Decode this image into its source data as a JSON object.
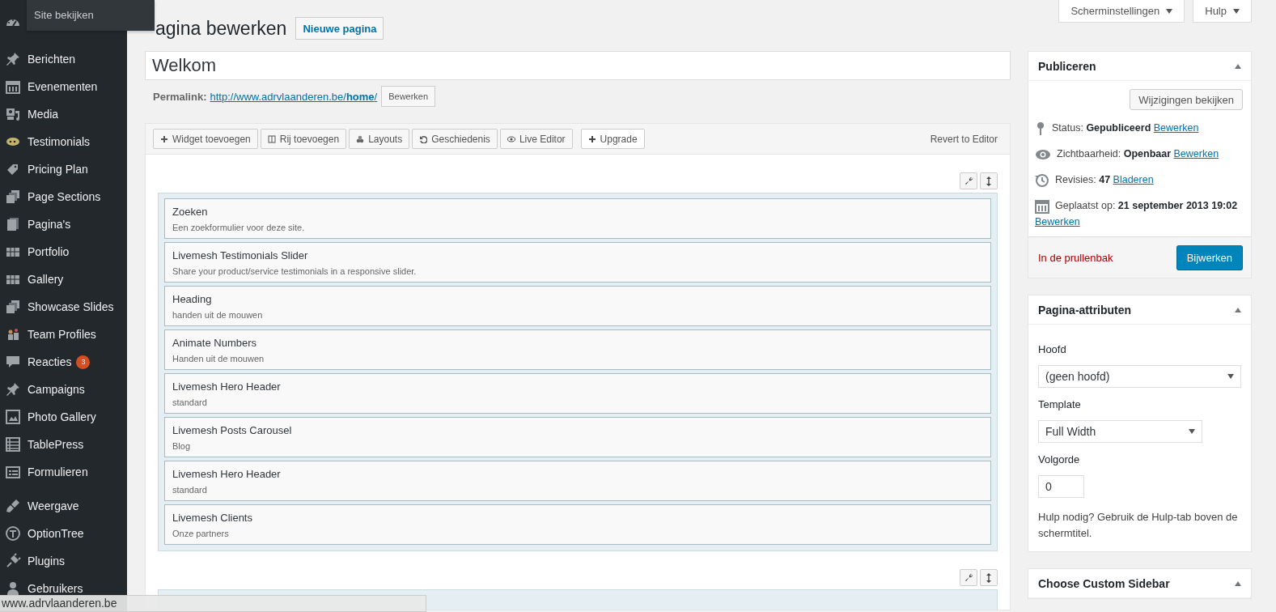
{
  "admin_bar": {
    "flyout": "Site bekijken"
  },
  "menu": {
    "groups": [
      [
        {
          "label": "Berichten"
        },
        {
          "label": "Evenementen"
        },
        {
          "label": "Media"
        },
        {
          "label": "Testimonials"
        },
        {
          "label": "Pricing Plan"
        },
        {
          "label": "Page Sections"
        },
        {
          "label": "Pagina's"
        },
        {
          "label": "Portfolio"
        },
        {
          "label": "Gallery"
        },
        {
          "label": "Showcase Slides"
        },
        {
          "label": "Team Profiles"
        },
        {
          "label": "Reacties",
          "badge": "3"
        },
        {
          "label": "Campaigns"
        },
        {
          "label": "Photo Gallery"
        },
        {
          "label": "TablePress"
        },
        {
          "label": "Formulieren"
        }
      ],
      [
        {
          "label": "Weergave"
        },
        {
          "label": "OptionTree"
        },
        {
          "label": "Plugins"
        },
        {
          "label": "Gebruikers"
        }
      ]
    ]
  },
  "screen_meta": {
    "buttons": [
      "Scherminstellingen",
      "Hulp"
    ]
  },
  "editor": {
    "heading": "agina bewerken",
    "add_new": "Nieuwe pagina",
    "title_value": "Welkom",
    "permalink": {
      "label": "Permalink:",
      "url": "http://www.adrvlaanderen.be/**home**/",
      "button": "Bewerken"
    }
  },
  "builder": {
    "toolbar": [
      {
        "kind": "add",
        "label": "Widget toevoegen"
      },
      {
        "kind": "row",
        "label": "Rij toevoegen"
      },
      {
        "kind": "layouts",
        "label": "Layouts"
      },
      {
        "kind": "history",
        "label": "Geschiedenis"
      },
      {
        "kind": "live",
        "label": "Live Editor"
      },
      {
        "kind": "upgrade",
        "label": "Upgrade"
      }
    ],
    "revert": "Revert to Editor",
    "rows": [
      {
        "widgets": [
          {
            "title": "Zoeken",
            "description": "Een zoekformulier voor deze site."
          },
          {
            "title": "Livemesh Testimonials Slider",
            "description": "Share your product/service testimonials in a responsive slider."
          },
          {
            "title": "Heading",
            "description": "handen uit de mouwen"
          },
          {
            "title": "Animate Numbers",
            "description": "Handen uit de mouwen"
          },
          {
            "title": "Livemesh Hero Header",
            "description": "standard"
          },
          {
            "title": "Livemesh Posts Carousel",
            "description": "Blog"
          },
          {
            "title": "Livemesh Hero Header",
            "description": "standard"
          },
          {
            "title": "Livemesh Clients",
            "description": "Onze partners"
          }
        ]
      },
      {}
    ]
  },
  "publish": {
    "title": "Publiceren",
    "preview": "Wijzigingen bekijken",
    "rows": [
      {
        "kind": "status",
        "label": "Status:",
        "value": "Gepubliceerd",
        "link": "Bewerken"
      },
      {
        "kind": "visibility",
        "label": "Zichtbaarheid:",
        "value": "Openbaar",
        "link": "Bewerken"
      },
      {
        "kind": "revisions",
        "label": "Revisies:",
        "value": "47",
        "link": "Bladeren"
      },
      {
        "kind": "date",
        "label": "Geplaatst op:",
        "value": "21 september 2013 19:02",
        "link": "Bewerken"
      }
    ],
    "trash": "In de prullenbak",
    "update": "Bijwerken"
  },
  "attributes": {
    "title": "Pagina-attributen",
    "fields": [
      {
        "kind": "select",
        "label": "Hoofd",
        "value": "(geen hoofd)"
      },
      {
        "kind": "select",
        "label": "Template",
        "value": "Full Width"
      },
      {
        "kind": "number",
        "label": "Volgorde",
        "value": "0"
      }
    ],
    "help": "Hulp nodig? Gebruik de Hulp-tab boven de schermtitel."
  },
  "custom_sidebar": {
    "title": "Choose Custom Sidebar"
  },
  "status_bar": {
    "url": "www.adrvlaanderen.be"
  }
}
